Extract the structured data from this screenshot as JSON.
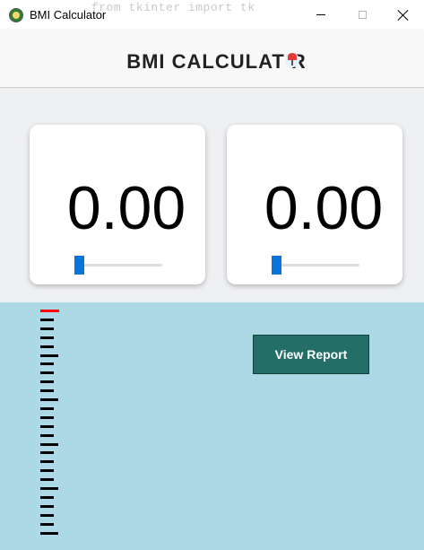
{
  "window": {
    "title": "BMI Calculator",
    "background_code_text": "from tkinter import tk",
    "controls": {
      "minimize": "minimize-icon",
      "maximize": "maximize-icon",
      "close": "close-icon"
    }
  },
  "header": {
    "title": "BMI CALCULAT  R",
    "logo_icon": "pin-icon"
  },
  "inputs": {
    "height": {
      "value": "0.00",
      "slider_level": 0
    },
    "weight": {
      "value": "0.00",
      "slider_level": 0
    },
    "slider_color": "#0a74da"
  },
  "scale": {
    "tick_count": 26,
    "pointer_color": "#ff0000"
  },
  "actions": {
    "view_report_label": "View Report"
  },
  "colors": {
    "header_bg": "#f8f8f8",
    "input_bg": "#eff0f2",
    "result_bg": "#add8e6",
    "button_bg": "#236f68"
  }
}
